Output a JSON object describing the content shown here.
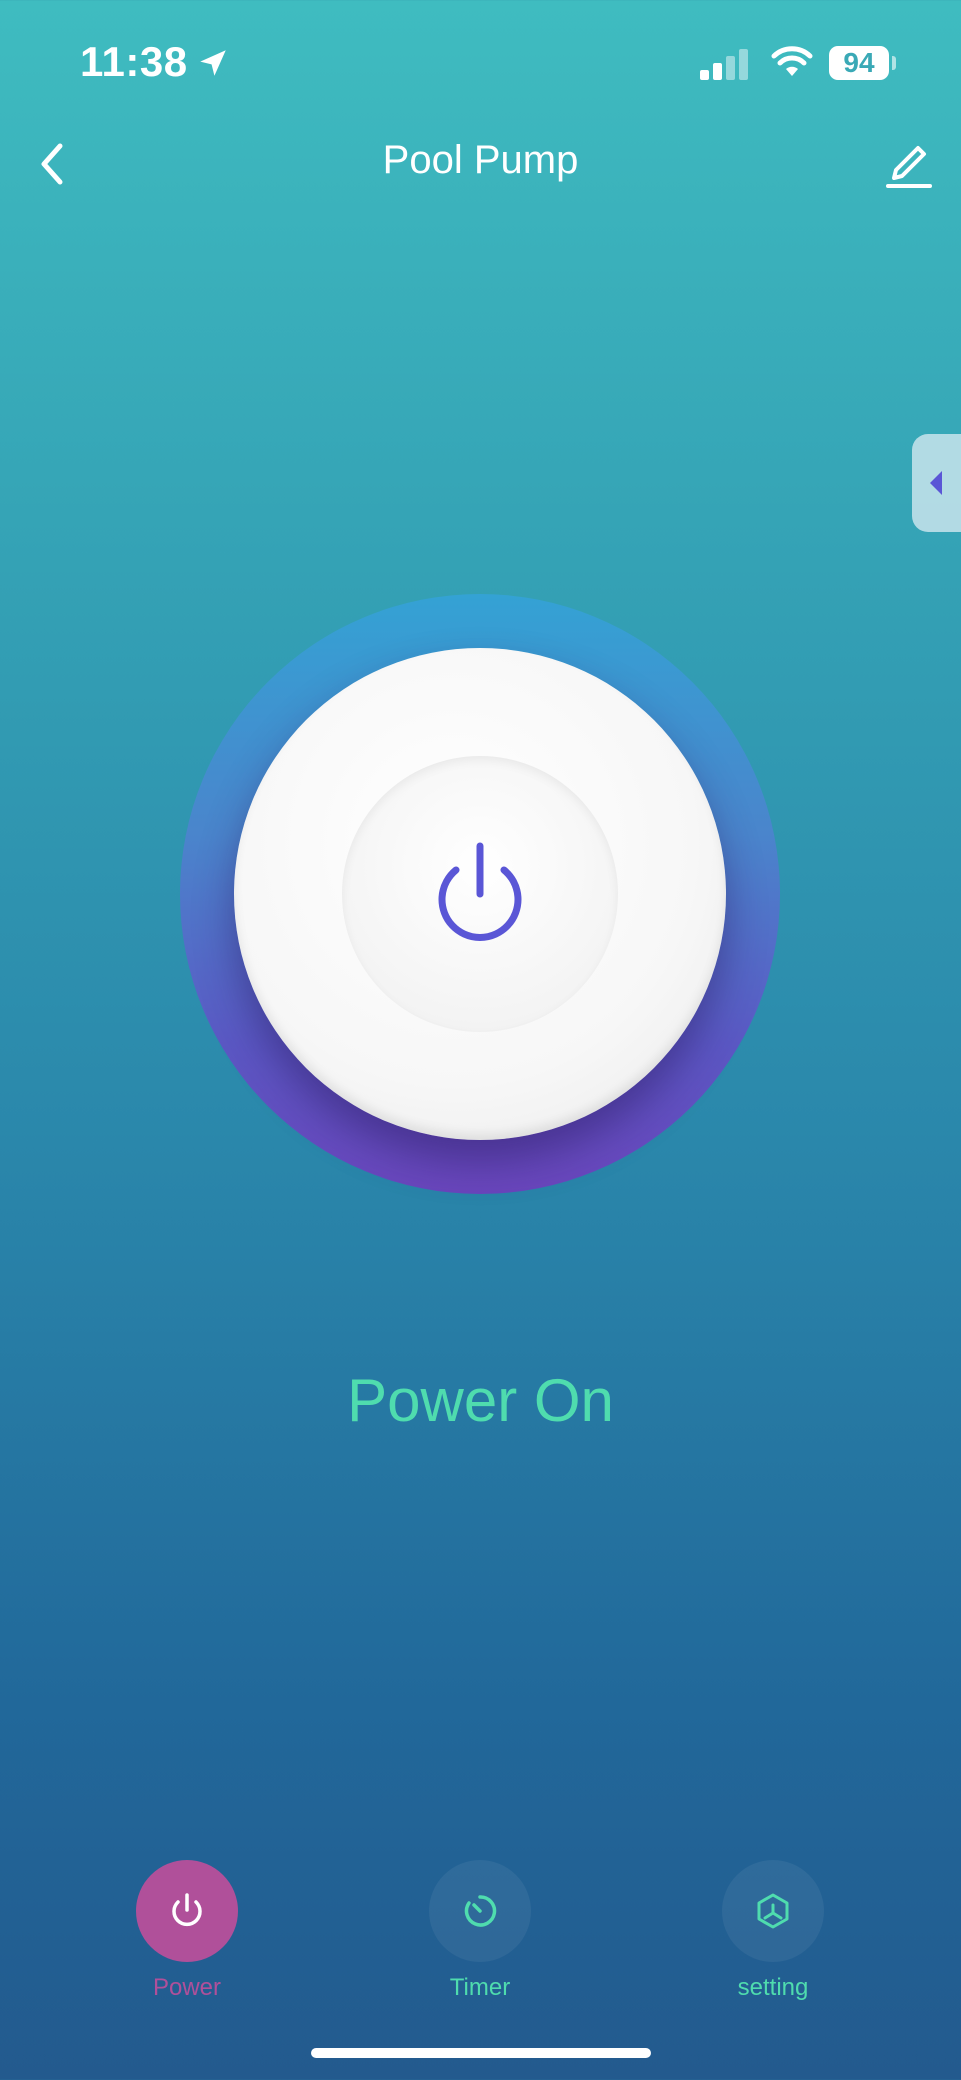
{
  "status_bar": {
    "time": "11:38",
    "battery": "94",
    "icons": [
      "location-arrow-icon",
      "cellular-signal-icon",
      "wifi-icon",
      "battery-icon"
    ]
  },
  "header": {
    "title": "Pool Pump",
    "back_icon": "chevron-left-icon",
    "edit_icon": "pencil-icon"
  },
  "drawer": {
    "icon": "triangle-left-icon"
  },
  "power": {
    "icon": "power-icon",
    "status": "Power On",
    "status_color": "#4fdcae"
  },
  "tabs": [
    {
      "label": "Power",
      "icon": "power-icon",
      "active": true,
      "color": "#b0509a"
    },
    {
      "label": "Timer",
      "icon": "timer-icon",
      "active": false,
      "color": "#4fdcae"
    },
    {
      "label": "setting",
      "icon": "cube-icon",
      "active": false,
      "color": "#4fdcae"
    }
  ],
  "colors": {
    "accent_purple": "#5a56d6",
    "active_tab": "#b0509a",
    "status_green": "#4fdcae"
  }
}
